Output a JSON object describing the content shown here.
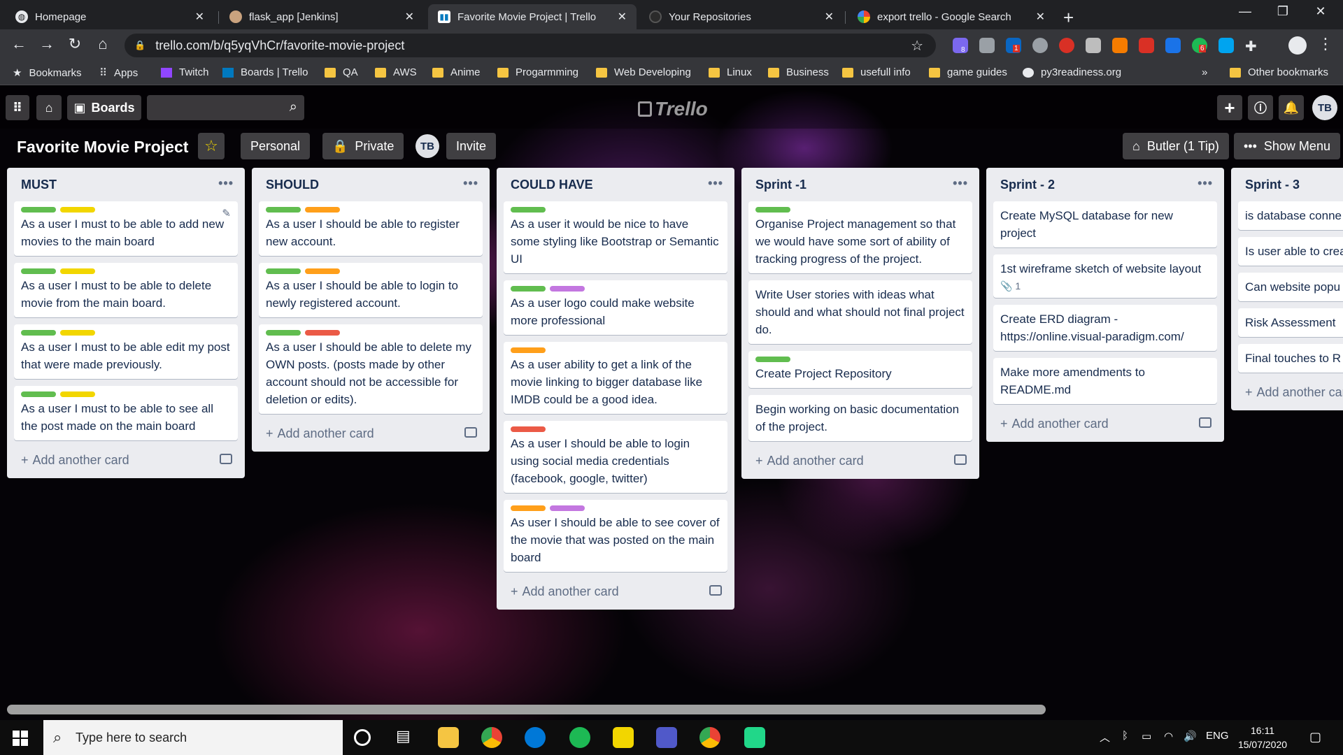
{
  "browser": {
    "tabs": [
      {
        "title": "Homepage",
        "active": false
      },
      {
        "title": "flask_app [Jenkins]",
        "active": false
      },
      {
        "title": "Favorite Movie Project | Trello",
        "active": true
      },
      {
        "title": "Your Repositories",
        "active": false
      },
      {
        "title": "export trello - Google Search",
        "active": false
      }
    ],
    "url": "trello.com/b/q5yqVhCr/favorite-movie-project",
    "bookmarks": [
      "Bookmarks",
      "Apps",
      "Twitch",
      "Boards | Trello",
      "QA",
      "AWS",
      "Anime",
      "Progarmming",
      "Web Developing",
      "Linux",
      "Business",
      "usefull info",
      "game guides",
      "py3readiness.org"
    ],
    "bookmarks_overflow": "»",
    "other_bookmarks": "Other bookmarks",
    "ext_badges": {
      "b1": "8",
      "b2": "1",
      "b3": "6"
    }
  },
  "trello": {
    "header": {
      "boards_label": "Boards",
      "logo": "Trello",
      "user_initials": "TB"
    },
    "board": {
      "name": "Favorite Movie Project",
      "team": "Personal",
      "visibility": "Private",
      "member_initials": "TB",
      "invite": "Invite",
      "butler": "Butler (1 Tip)",
      "show_menu": "Show Menu"
    },
    "add_card": "Add another card",
    "colors": {
      "green": "#61bd4f",
      "yellow": "#f2d600",
      "orange": "#ff9f1a",
      "red": "#eb5a46",
      "purple": "#c377e0"
    },
    "lists": [
      {
        "title": "MUST",
        "cards": [
          {
            "labels": [
              "green",
              "yellow"
            ],
            "text": "As a user I must to be able to add new movies to the main board"
          },
          {
            "labels": [
              "green",
              "yellow"
            ],
            "text": "As a user I must to be able to delete movie from the main board."
          },
          {
            "labels": [
              "green",
              "yellow"
            ],
            "text": "As a user I must to be able edit my post that were made previously."
          },
          {
            "labels": [
              "green",
              "yellow"
            ],
            "text": "As a user I must to be able to see all the post made on the main board"
          }
        ]
      },
      {
        "title": "SHOULD",
        "cards": [
          {
            "labels": [
              "green",
              "orange"
            ],
            "text": "As a user I should be able to register new account."
          },
          {
            "labels": [
              "green",
              "orange"
            ],
            "text": "As a user I should be able to login to newly registered account."
          },
          {
            "labels": [
              "green",
              "red"
            ],
            "text": "As a user I should be able to delete my OWN posts. (posts made by other account should not be accessible for deletion or edits)."
          }
        ]
      },
      {
        "title": "COULD HAVE",
        "cards": [
          {
            "labels": [
              "green"
            ],
            "text": "As a user it would be nice to have some styling like Bootstrap or Semantic UI"
          },
          {
            "labels": [
              "green",
              "purple"
            ],
            "text": "As a user logo could make website more professional"
          },
          {
            "labels": [
              "orange"
            ],
            "text": "As a user ability to get a link of the movie linking to bigger database like IMDB could be a good idea."
          },
          {
            "labels": [
              "red"
            ],
            "text": "As a user I should be able to login using social media credentials (facebook, google, twitter)"
          },
          {
            "labels": [
              "orange",
              "purple"
            ],
            "text": "As user I should be able to see cover of the movie that was posted on the main board"
          }
        ]
      },
      {
        "title": "Sprint -1",
        "cards": [
          {
            "labels": [
              "green"
            ],
            "text": "Organise Project management so that we would have some sort of ability of tracking progress of the project."
          },
          {
            "labels": [],
            "text": "Write User stories with ideas what should and what should not final project do."
          },
          {
            "labels": [
              "green"
            ],
            "text": "Create Project Repository"
          },
          {
            "labels": [],
            "text": "Begin working on basic documentation of the project."
          }
        ]
      },
      {
        "title": "Sprint - 2",
        "cards": [
          {
            "labels": [],
            "text": "Create MySQL database for new project"
          },
          {
            "labels": [],
            "text": "1st wireframe sketch of website layout",
            "attachments": "1"
          },
          {
            "labels": [],
            "text": "Create ERD diagram - https://online.visual-paradigm.com/"
          },
          {
            "labels": [],
            "text": "Make more amendments to README.md"
          }
        ]
      },
      {
        "title": "Sprint - 3",
        "cards": [
          {
            "labels": [],
            "text": "is database conne and working ok?"
          },
          {
            "labels": [],
            "text": "Is user able to crea log in using same"
          },
          {
            "labels": [],
            "text": "Can website popu request by user?"
          },
          {
            "labels": [],
            "text": "Risk Assessment"
          },
          {
            "labels": [],
            "text": "Final touches to R"
          }
        ]
      }
    ]
  },
  "taskbar": {
    "search_placeholder": "Type here to search",
    "language": "ENG",
    "time": "16:11",
    "date": "15/07/2020"
  }
}
